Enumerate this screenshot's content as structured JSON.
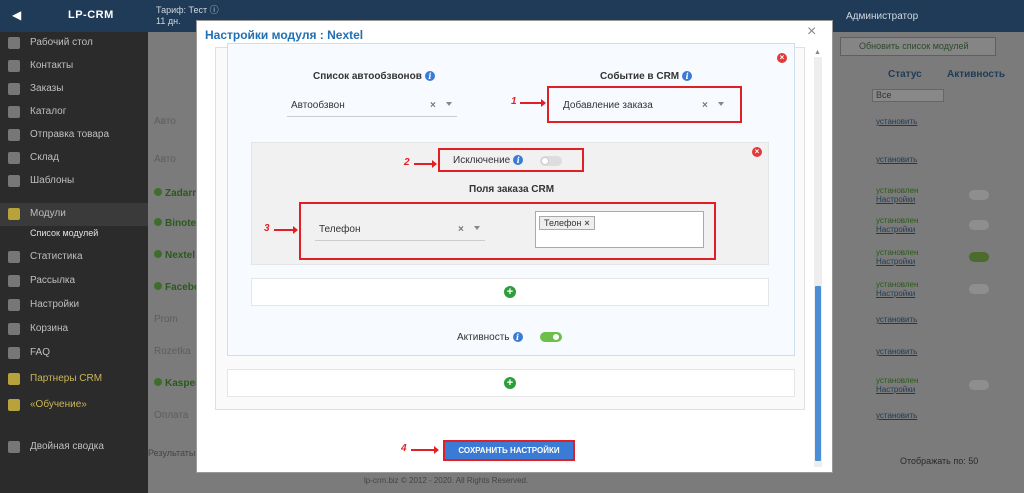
{
  "background": {
    "topbar": {
      "logo": "LP-CRM",
      "tariff": "Тариф: Тест ⓘ",
      "tariff_days": "11 дн.",
      "user": "Администратор"
    },
    "sidebar": {
      "items": [
        {
          "label": "Рабочий стол"
        },
        {
          "label": "Контакты"
        },
        {
          "label": "Заказы"
        },
        {
          "label": "Каталог"
        },
        {
          "label": "Отправка товара"
        },
        {
          "label": "Склад"
        },
        {
          "label": "Шаблоны"
        },
        {
          "label": "Модули"
        },
        {
          "label": "Список модулей"
        },
        {
          "label": "Статистика"
        },
        {
          "label": "Рассылка"
        },
        {
          "label": "Настройки"
        },
        {
          "label": "Корзина"
        },
        {
          "label": "FAQ"
        },
        {
          "label": "Партнеры CRM"
        },
        {
          "label": "«Обучение»"
        },
        {
          "label": "Двойная сводка"
        }
      ]
    },
    "refresh_label": "Обновить список модулей",
    "columns": {
      "status": "Статус",
      "activity": "Активность"
    },
    "filter": "Все",
    "rows": [
      {
        "name": "Авто",
        "status": "установить",
        "installed": false,
        "active": false
      },
      {
        "name": "Авто",
        "status": "установить",
        "installed": false,
        "active": false
      },
      {
        "name": "Zadarma",
        "status": "установлен",
        "sub": "Настройки",
        "installed": true,
        "active": false
      },
      {
        "name": "Binotel",
        "status": "установлен",
        "sub": "Настройки",
        "installed": true,
        "active": false
      },
      {
        "name": "Nextel",
        "status": "установлен",
        "sub": "Настройки",
        "installed": true,
        "active": true
      },
      {
        "name": "Facebook",
        "status": "установлен",
        "sub": "Настройки",
        "installed": true,
        "active": false
      },
      {
        "name": "Prom",
        "status": "установить",
        "installed": false,
        "active": false
      },
      {
        "name": "Rozetka",
        "status": "установить",
        "installed": false,
        "active": false
      },
      {
        "name": "Kasper",
        "status": "установлен",
        "sub": "Настройки",
        "installed": true,
        "active": false
      },
      {
        "name": "Оплата",
        "status": "установить",
        "installed": false,
        "active": false
      }
    ],
    "bottom_text": "Результаты 1 - 10 из 10",
    "per_page": "Отображать по: 50",
    "footer": "lp-crm.biz © 2012 - 2020. All Rights Reserved."
  },
  "modal": {
    "title": "Настройки модуля : Nextel",
    "close": "×",
    "autodial_label": "Список автообзвонов",
    "autodial_value": "Автообзвон",
    "event_label": "Событие в CRM",
    "event_value": "Добавление заказа",
    "exclusion_label": "Исключение",
    "fields_label": "Поля заказа CRM",
    "field_value": "Телефон",
    "tag_value": "Телефон",
    "activity_label": "Активность",
    "activity_on": true,
    "exclusion_on": false,
    "save_label": "СОХРАНИТЬ НАСТРОЙКИ"
  },
  "annotations": {
    "n1": "1",
    "n2": "2",
    "n3": "3",
    "n4": "4"
  },
  "colors": {
    "accent": "#3a7bd5",
    "highlight": "#e31f26",
    "success": "#2e9e3a",
    "danger": "#e23a3a"
  }
}
